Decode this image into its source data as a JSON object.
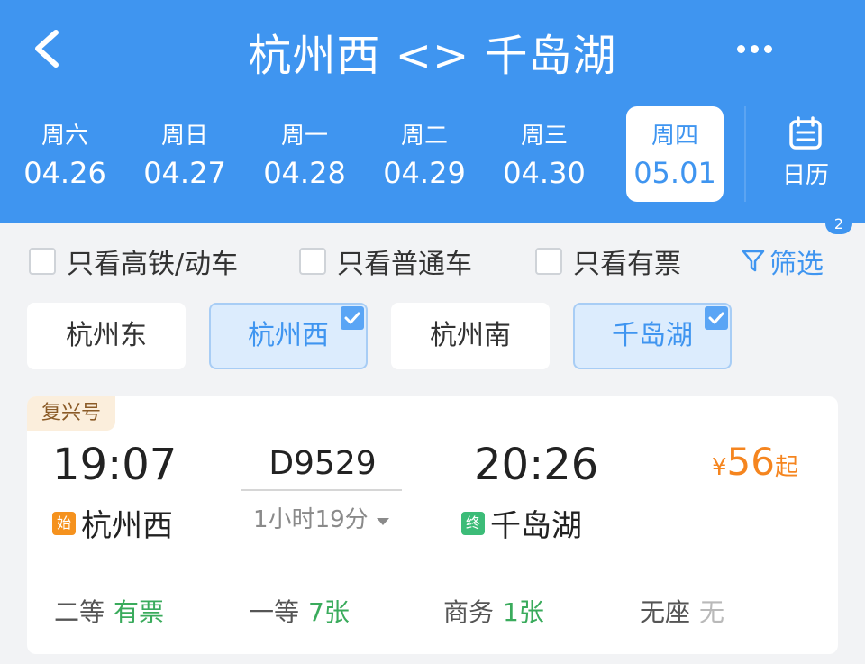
{
  "header": {
    "title": "杭州西 <> 千岛湖",
    "dates": [
      {
        "weekday": "周六",
        "date": "04.26"
      },
      {
        "weekday": "周日",
        "date": "04.27"
      },
      {
        "weekday": "周一",
        "date": "04.28"
      },
      {
        "weekday": "周二",
        "date": "04.29"
      },
      {
        "weekday": "周三",
        "date": "04.30"
      },
      {
        "weekday": "周四",
        "date": "05.01",
        "selected": true
      }
    ],
    "calendar_label": "日历",
    "badge": "2"
  },
  "filters": {
    "high_speed_only": "只看高铁/动车",
    "regular_only": "只看普通车",
    "available_only": "只看有票",
    "filter_button": "筛选"
  },
  "stations": [
    {
      "name": "杭州东",
      "selected": false
    },
    {
      "name": "杭州西",
      "selected": true
    },
    {
      "name": "杭州南",
      "selected": false
    },
    {
      "name": "千岛湖",
      "selected": true
    }
  ],
  "train": {
    "tag": "复兴号",
    "depart_time": "19:07",
    "arrive_time": "20:26",
    "train_no": "D9529",
    "duration": "1小时19分",
    "depart_badge": "始",
    "arrive_badge": "终",
    "depart_station": "杭州西",
    "arrive_station": "千岛湖",
    "price_currency": "¥",
    "price": "56",
    "price_suffix": "起",
    "seats": [
      {
        "class": "二等",
        "status": "有票",
        "available": true
      },
      {
        "class": "一等",
        "status": "7张",
        "available": true
      },
      {
        "class": "商务",
        "status": "1张",
        "available": true
      },
      {
        "class": "无座",
        "status": "无",
        "available": false
      }
    ]
  },
  "colors": {
    "primary": "#3f95f0",
    "price": "#f5851f",
    "available": "#3aab5c",
    "depart_badge": "#f5921e",
    "arrive_badge": "#3cbc78"
  }
}
